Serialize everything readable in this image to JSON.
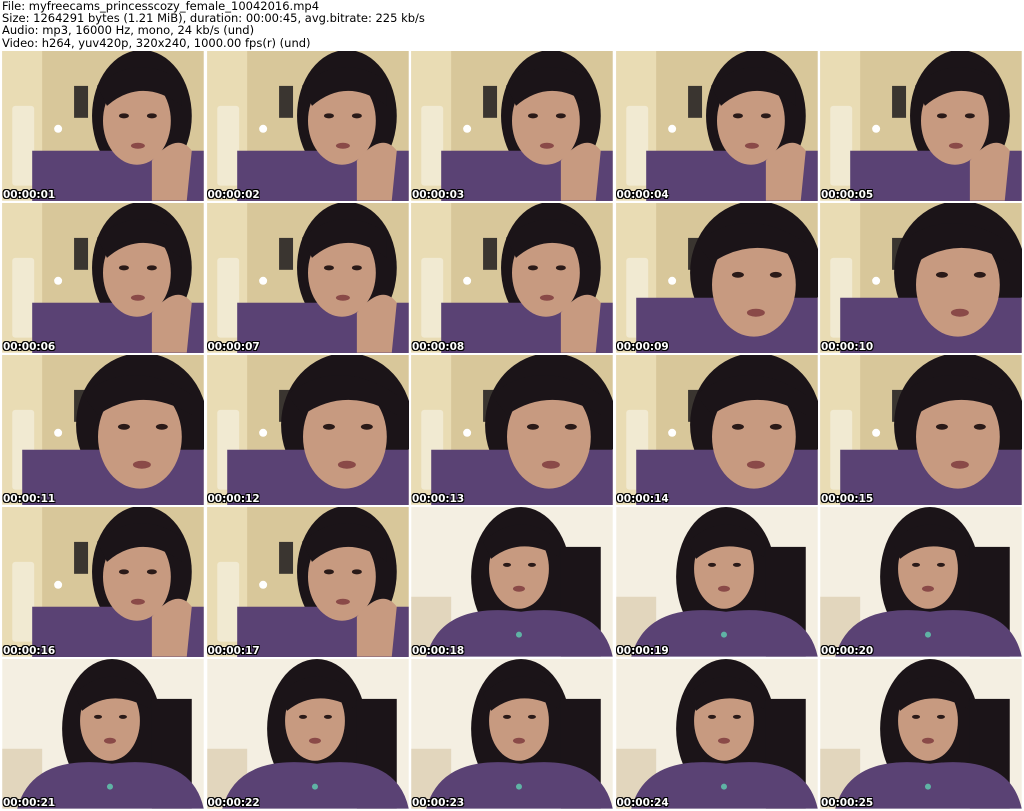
{
  "header": {
    "file_line": "File: myfreecams_princesscozy_female_10042016.mp4",
    "size_line": "Size: 1264291 bytes (1.21 MiB), duration: 00:00:45, avg.bitrate: 225 kb/s",
    "audio_line": "Audio: mp3, 16000 Hz, mono, 24 kb/s (und)",
    "video_line": "Video: h264, yuv420p, 320x240, 1000.00 fps(r) (und)"
  },
  "thumbnails": [
    {
      "timestamp": "00:00:01",
      "pose": "hand"
    },
    {
      "timestamp": "00:00:02",
      "pose": "hand"
    },
    {
      "timestamp": "00:00:03",
      "pose": "hand"
    },
    {
      "timestamp": "00:00:04",
      "pose": "hand"
    },
    {
      "timestamp": "00:00:05",
      "pose": "hand"
    },
    {
      "timestamp": "00:00:06",
      "pose": "hand"
    },
    {
      "timestamp": "00:00:07",
      "pose": "hand"
    },
    {
      "timestamp": "00:00:08",
      "pose": "hand"
    },
    {
      "timestamp": "00:00:09",
      "pose": "close"
    },
    {
      "timestamp": "00:00:10",
      "pose": "close"
    },
    {
      "timestamp": "00:00:11",
      "pose": "close"
    },
    {
      "timestamp": "00:00:12",
      "pose": "close"
    },
    {
      "timestamp": "00:00:13",
      "pose": "close"
    },
    {
      "timestamp": "00:00:14",
      "pose": "close"
    },
    {
      "timestamp": "00:00:15",
      "pose": "close"
    },
    {
      "timestamp": "00:00:16",
      "pose": "hand"
    },
    {
      "timestamp": "00:00:17",
      "pose": "hand"
    },
    {
      "timestamp": "00:00:18",
      "pose": "upright"
    },
    {
      "timestamp": "00:00:19",
      "pose": "upright"
    },
    {
      "timestamp": "00:00:20",
      "pose": "upright"
    },
    {
      "timestamp": "00:00:21",
      "pose": "upright"
    },
    {
      "timestamp": "00:00:22",
      "pose": "upright"
    },
    {
      "timestamp": "00:00:23",
      "pose": "upright"
    },
    {
      "timestamp": "00:00:24",
      "pose": "upright"
    },
    {
      "timestamp": "00:00:25",
      "pose": "upright"
    }
  ],
  "colors": {
    "wall": "#d8c79a",
    "wall_light": "#e9dcb4",
    "lamp": "#f1ead2",
    "shirt": "#5a4274",
    "hair": "#1b1418",
    "skin": "#c79a80",
    "overexposed": "#f4efe2"
  }
}
